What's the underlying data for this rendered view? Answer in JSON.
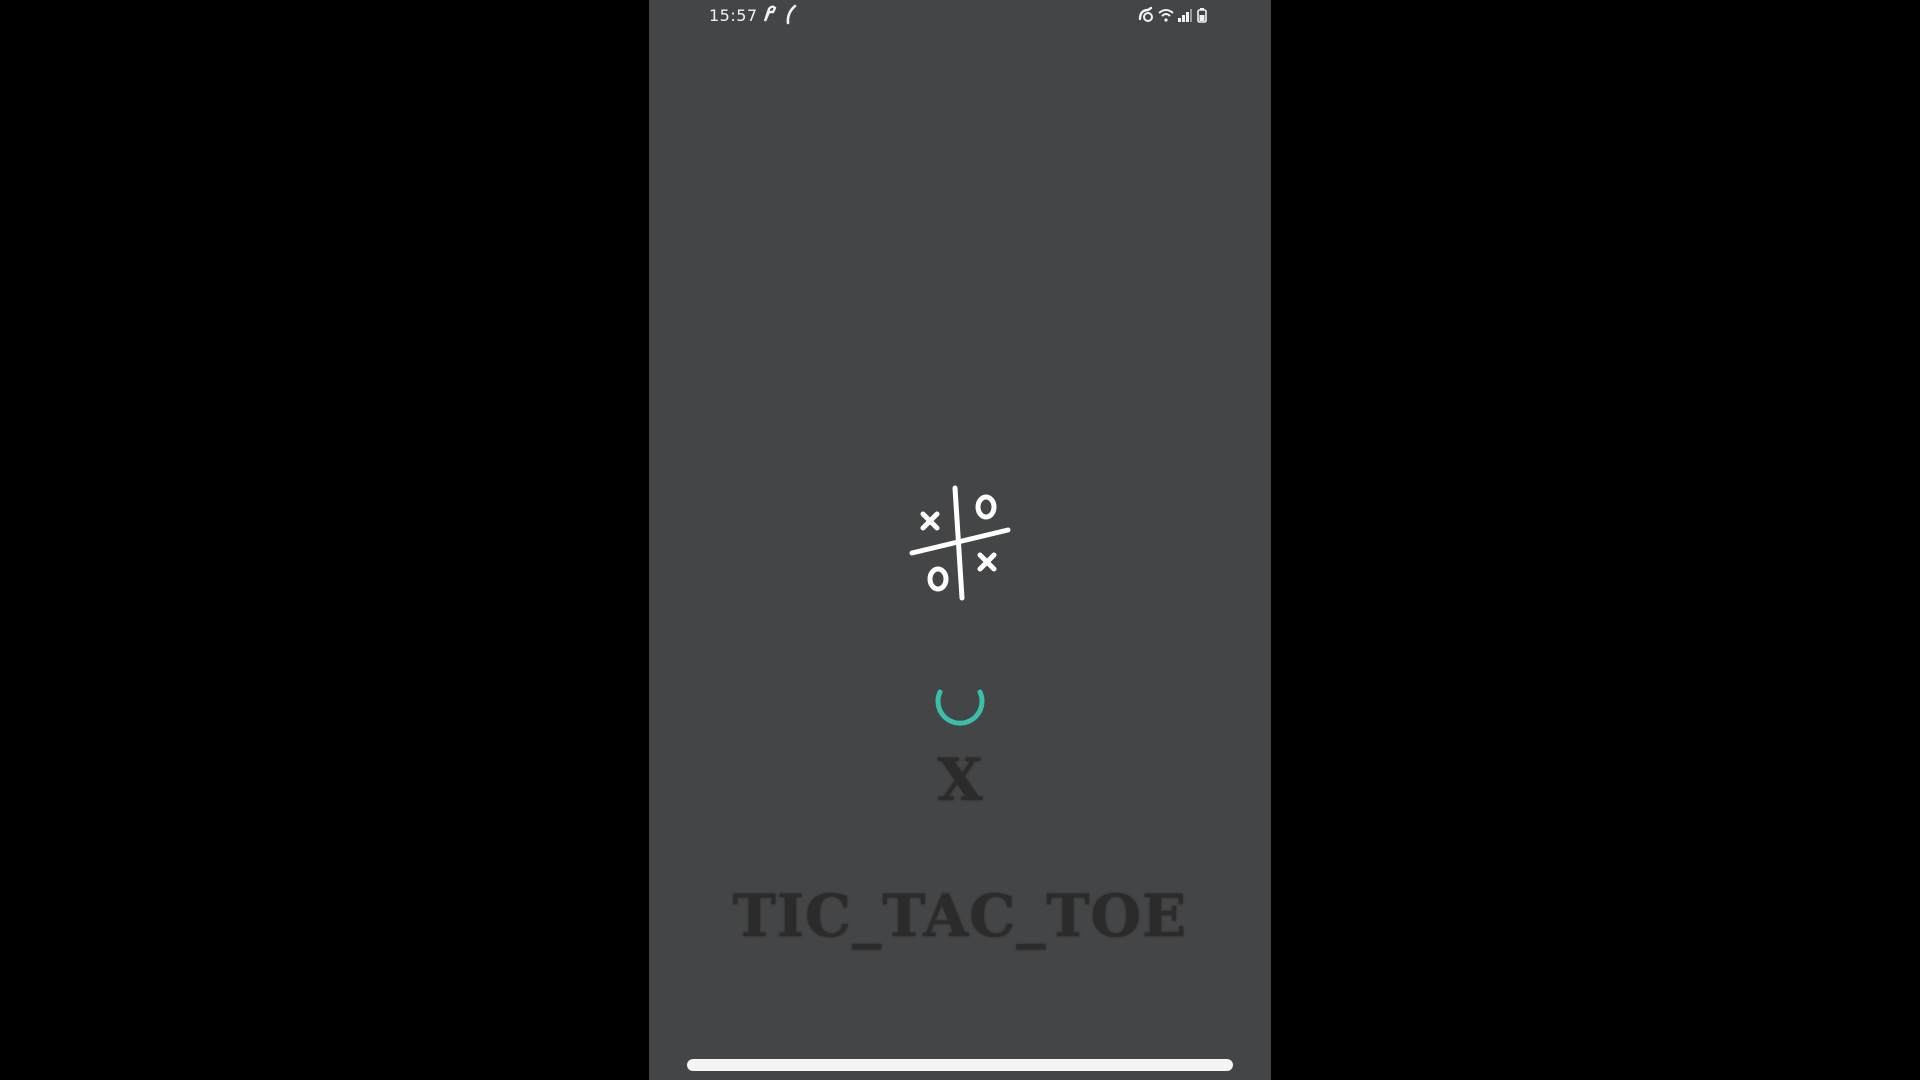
{
  "status_bar": {
    "time": "15:57",
    "left_icons": [
      "notification-icon",
      "notification-icon-2"
    ],
    "right_icons": [
      "alarm-icon",
      "wifi-icon",
      "signal-icon",
      "battery-icon"
    ]
  },
  "app": {
    "logo_icon": "tic-tac-toe-logo-icon",
    "loading": true,
    "turn_symbol": "X",
    "title": "TIC_TAC_TOE"
  },
  "colors": {
    "background": "#444546",
    "letterbox": "#000000",
    "spinner": "#3bbfa6",
    "title_text": "#2b2b2c",
    "logo": "#ffffff"
  }
}
